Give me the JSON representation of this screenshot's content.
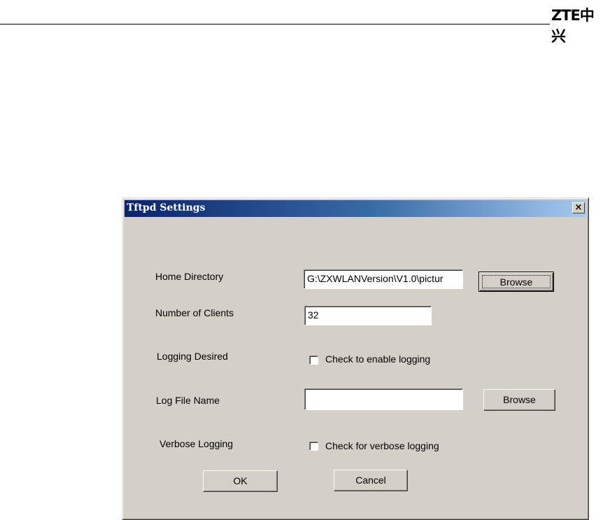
{
  "page": {
    "logo": "ZTE中兴"
  },
  "dialog": {
    "title": "Tftpd Settings",
    "close_glyph": "×",
    "home_directory": {
      "label": "Home Directory",
      "value": "G:\\ZXWLANVersion\\V1.0\\pictur",
      "browse_label": "Browse"
    },
    "number_of_clients": {
      "label": "Number of Clients",
      "value": "32"
    },
    "logging_desired": {
      "label": "Logging Desired",
      "checkbox_label": "Check to enable logging",
      "checked": false
    },
    "log_file_name": {
      "label": "Log File Name",
      "value": "",
      "browse_label": "Browse"
    },
    "verbose_logging": {
      "label": "Verbose Logging",
      "checkbox_label": "Check for verbose logging",
      "checked": false
    },
    "ok_label": "OK",
    "cancel_label": "Cancel"
  }
}
